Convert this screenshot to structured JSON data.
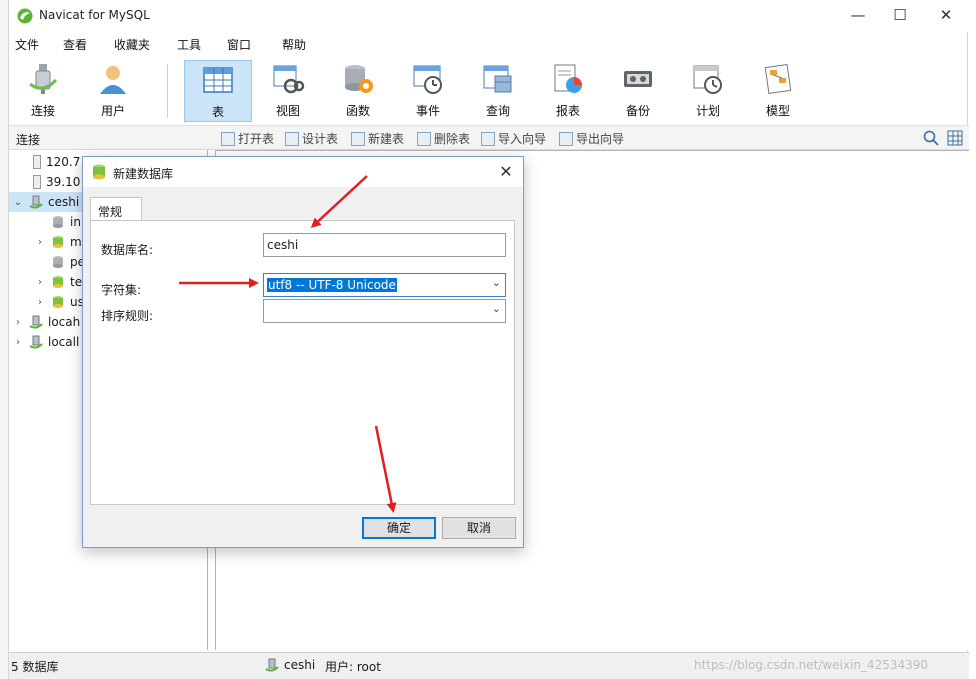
{
  "window": {
    "title": "Navicat for MySQL",
    "minimize": "—",
    "maximize": "☐",
    "close": "✕"
  },
  "menu": [
    "文件",
    "查看",
    "收藏夹",
    "工具",
    "窗口",
    "帮助"
  ],
  "toolbar": [
    {
      "label": "连接",
      "icon": "plug-icon"
    },
    {
      "label": "用户",
      "icon": "user-icon"
    },
    {
      "label": "表",
      "icon": "table-icon",
      "active": true
    },
    {
      "label": "视图",
      "icon": "view-icon"
    },
    {
      "label": "函数",
      "icon": "function-icon"
    },
    {
      "label": "事件",
      "icon": "event-icon"
    },
    {
      "label": "查询",
      "icon": "query-icon"
    },
    {
      "label": "报表",
      "icon": "report-icon"
    },
    {
      "label": "备份",
      "icon": "backup-icon"
    },
    {
      "label": "计划",
      "icon": "schedule-icon"
    },
    {
      "label": "模型",
      "icon": "model-icon"
    }
  ],
  "subbar": {
    "connection_header": "连接",
    "buttons": [
      "打开表",
      "设计表",
      "新建表",
      "删除表",
      "导入向导",
      "导出向导"
    ]
  },
  "tree": [
    {
      "label": "120.7",
      "level": 1,
      "arrow": "",
      "kind": "server"
    },
    {
      "label": "39.10",
      "level": 1,
      "arrow": "",
      "kind": "server"
    },
    {
      "label": "ceshi",
      "level": 0,
      "arrow": "⌄",
      "kind": "connection",
      "selected": true
    },
    {
      "label": "in",
      "level": 2,
      "arrow": "",
      "kind": "db-gray"
    },
    {
      "label": "m",
      "level": 2,
      "arrow": "›",
      "kind": "db"
    },
    {
      "label": "pe",
      "level": 2,
      "arrow": "",
      "kind": "db-gray"
    },
    {
      "label": "te",
      "level": 2,
      "arrow": "›",
      "kind": "db"
    },
    {
      "label": "us",
      "level": 2,
      "arrow": "›",
      "kind": "db"
    },
    {
      "label": "locah",
      "level": 0,
      "arrow": "›",
      "kind": "connection"
    },
    {
      "label": "locall",
      "level": 0,
      "arrow": "›",
      "kind": "connection"
    }
  ],
  "status": {
    "db_count": "5 数据库",
    "connection": "ceshi",
    "user": "用户: root",
    "watermark": "https://blog.csdn.net/weixin_42534390"
  },
  "dialog": {
    "title": "新建数据库",
    "close": "✕",
    "tab": "常规",
    "db_name_label": "数据库名:",
    "db_name_value": "ceshi",
    "charset_label": "字符集:",
    "charset_value": "utf8 -- UTF-8 Unicode",
    "collation_label": "排序规则:",
    "collation_value": "",
    "ok": "确定",
    "cancel": "取消"
  },
  "colors": {
    "accent": "#0078d7",
    "arrow": "#e02020",
    "selection": "#cce4f7"
  }
}
